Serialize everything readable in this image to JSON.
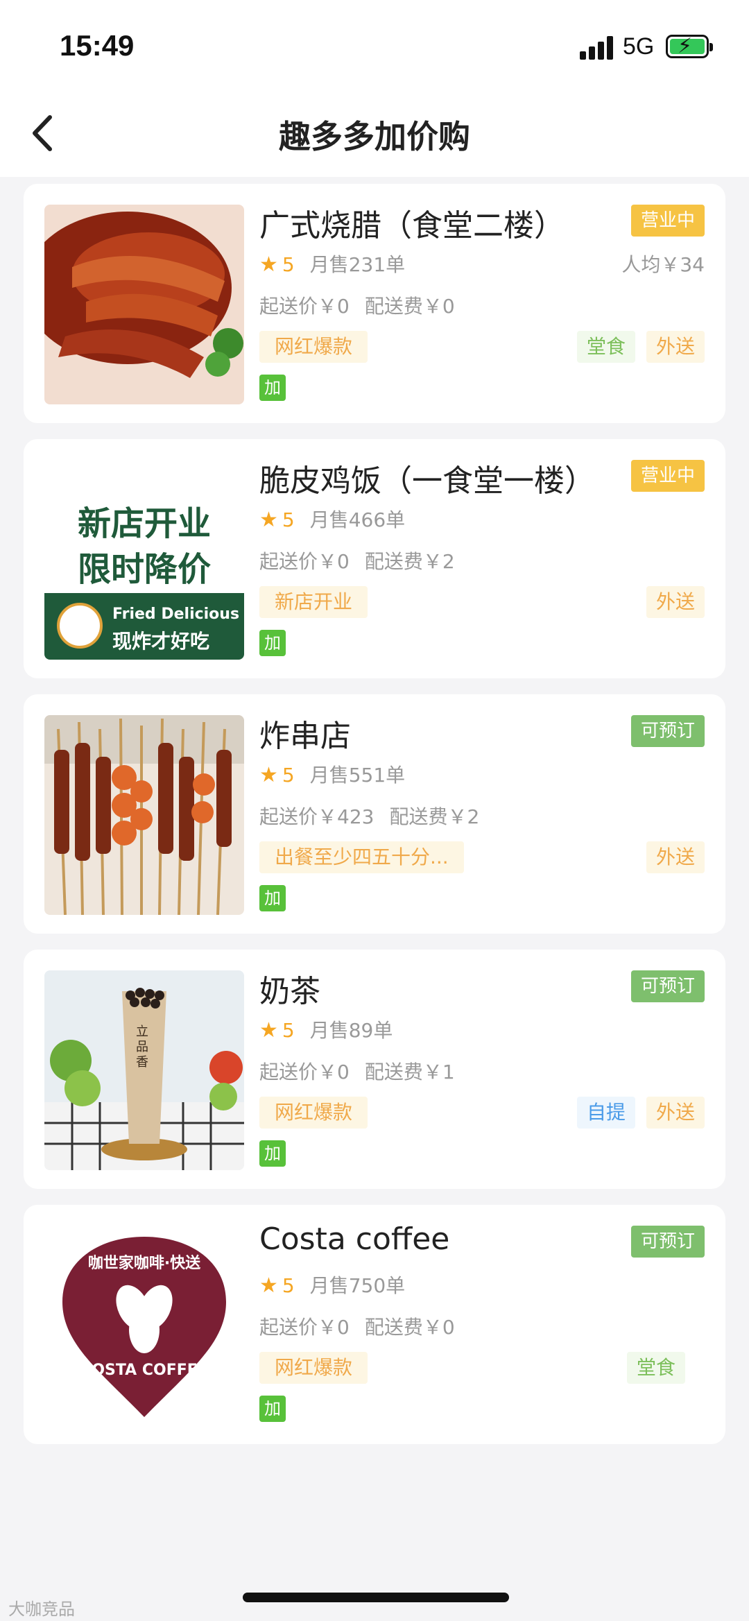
{
  "status_bar": {
    "time": "15:49",
    "network": "5G"
  },
  "header": {
    "title": "趣多多加价购"
  },
  "colors": {
    "open": "#f6c343",
    "preorder": "#7ebf6d",
    "add": "#58c13a",
    "star": "#f5a623"
  },
  "stores": [
    {
      "name": "广式烧腊（食堂二楼）",
      "status": "营业中",
      "rating": "5",
      "sales": "月售231单",
      "avg_price": "人均￥34",
      "min_order": "起送价￥0",
      "delivery_fee": "配送费￥0",
      "promo": "网红爆款",
      "tags": {
        "dine": "堂食",
        "deliver": "外送"
      },
      "add": "加"
    },
    {
      "name": "脆皮鸡饭（一食堂一楼）",
      "status": "营业中",
      "rating": "5",
      "sales": "月售466单",
      "min_order": "起送价￥0",
      "delivery_fee": "配送费￥2",
      "promo": "新店开业",
      "tags": {
        "deliver": "外送"
      },
      "thumb_text": {
        "line1": "新店开业",
        "line2": "限时降价",
        "en": "Fried Delicious",
        "cn": "现炸才好吃"
      },
      "add": "加"
    },
    {
      "name": "炸串店",
      "status": "可预订",
      "rating": "5",
      "sales": "月售551单",
      "min_order": "起送价￥423",
      "delivery_fee": "配送费￥2",
      "promo": "出餐至少四五十分...",
      "tags": {
        "deliver": "外送"
      },
      "add": "加"
    },
    {
      "name": "奶茶",
      "status": "可预订",
      "rating": "5",
      "sales": "月售89单",
      "min_order": "起送价￥0",
      "delivery_fee": "配送费￥1",
      "promo": "网红爆款",
      "tags": {
        "pickup": "自提",
        "deliver": "外送"
      },
      "thumb_text": {
        "brand": "立品香"
      },
      "add": "加"
    },
    {
      "name": "Costa coffee",
      "status": "可预订",
      "rating": "5",
      "sales": "月售750单",
      "min_order": "起送价￥0",
      "delivery_fee": "配送费￥0",
      "promo": "网红爆款",
      "tags": {
        "dine": "堂食"
      },
      "thumb_text": {
        "top": "咖世家咖啡·快送",
        "bottom": "COSTA COFFEE"
      },
      "add": "加"
    }
  ],
  "watermark": "大咖竞品"
}
